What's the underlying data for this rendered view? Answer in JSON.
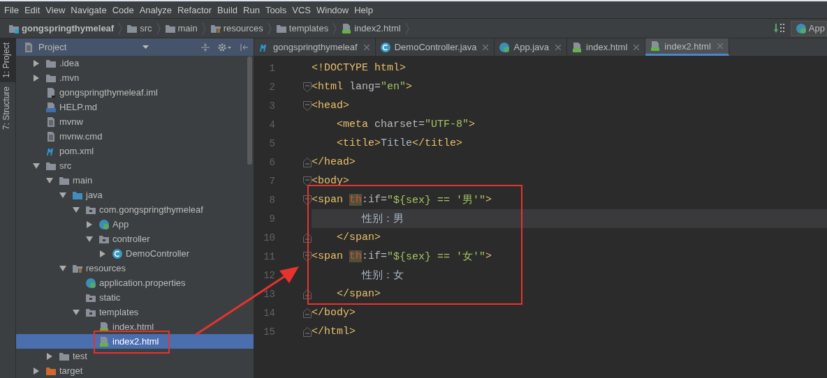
{
  "menu": [
    "File",
    "Edit",
    "View",
    "Navigate",
    "Code",
    "Analyze",
    "Refactor",
    "Build",
    "Run",
    "Tools",
    "VCS",
    "Window",
    "Help"
  ],
  "breadcrumb": [
    {
      "label": "gongspringthymeleaf",
      "kind": "module"
    },
    {
      "label": "src",
      "kind": "folder"
    },
    {
      "label": "main",
      "kind": "folder"
    },
    {
      "label": "resources",
      "kind": "resources"
    },
    {
      "label": "templates",
      "kind": "folder"
    },
    {
      "label": "index2.html",
      "kind": "html"
    }
  ],
  "run_config": {
    "label": "App"
  },
  "tool_strip": [
    {
      "label": "1: Project",
      "selected": true
    },
    {
      "label": "7: Structure",
      "selected": false
    }
  ],
  "project": {
    "title": "Project",
    "tree": [
      {
        "label": ".idea",
        "kind": "folder",
        "expanded": false,
        "selected": false
      },
      {
        "label": ".mvn",
        "kind": "folder",
        "expanded": false,
        "selected": false
      },
      {
        "label": "gongspringthymeleaf.iml",
        "kind": "iml",
        "selected": false
      },
      {
        "label": "HELP.md",
        "kind": "md",
        "selected": false
      },
      {
        "label": "mvnw",
        "kind": "text",
        "selected": false
      },
      {
        "label": "mvnw.cmd",
        "kind": "text",
        "selected": false
      },
      {
        "label": "pom.xml",
        "kind": "maven",
        "selected": false
      },
      {
        "label": "src",
        "kind": "folder",
        "expanded": true,
        "selected": false,
        "children": [
          {
            "label": "main",
            "kind": "folder",
            "expanded": true,
            "selected": false,
            "children": [
              {
                "label": "java",
                "kind": "source",
                "expanded": true,
                "selected": false,
                "children": [
                  {
                    "label": "com.gongspringthymeleaf",
                    "kind": "package",
                    "expanded": true,
                    "selected": false,
                    "children": [
                      {
                        "label": "App",
                        "kind": "spring",
                        "expanded": false,
                        "selected": false
                      },
                      {
                        "label": "controller",
                        "kind": "package",
                        "expanded": true,
                        "selected": false,
                        "children": [
                          {
                            "label": "DemoController",
                            "kind": "class",
                            "expanded": false,
                            "selected": false
                          }
                        ]
                      }
                    ]
                  }
                ]
              },
              {
                "label": "resources",
                "kind": "resources",
                "expanded": true,
                "selected": false,
                "children": [
                  {
                    "label": "application.properties",
                    "kind": "spring",
                    "selected": false
                  },
                  {
                    "label": "static",
                    "kind": "package",
                    "selected": false
                  },
                  {
                    "label": "templates",
                    "kind": "package",
                    "expanded": true,
                    "selected": false,
                    "children": [
                      {
                        "label": "index.html",
                        "kind": "html",
                        "selected": false
                      },
                      {
                        "label": "index2.html",
                        "kind": "html",
                        "selected": true
                      }
                    ]
                  }
                ]
              }
            ]
          },
          {
            "label": "test",
            "kind": "folder",
            "expanded": false,
            "selected": false
          }
        ]
      },
      {
        "label": "target",
        "kind": "excluded",
        "expanded": false,
        "selected": false
      }
    ]
  },
  "tabs": [
    {
      "label": "gongspringthymeleaf",
      "kind": "maven",
      "selected": false
    },
    {
      "label": "DemoController.java",
      "kind": "class",
      "selected": false
    },
    {
      "label": "App.java",
      "kind": "spring",
      "selected": false
    },
    {
      "label": "index.html",
      "kind": "html",
      "selected": false
    },
    {
      "label": "index2.html",
      "kind": "html",
      "selected": true
    }
  ],
  "editor": {
    "lines": [
      {
        "number": "1",
        "kind": "plain",
        "current": false,
        "tokens": [
          {
            "text": "<!DOCTYPE html>",
            "kind": "tag"
          }
        ]
      },
      {
        "number": "2",
        "kind": "foldstart",
        "current": false,
        "tokens": [
          {
            "text": "<html",
            "kind": "tag"
          },
          {
            "text": " lang=",
            "kind": "attr"
          },
          {
            "text": "\"en\"",
            "kind": "string"
          },
          {
            "text": ">",
            "kind": "tag"
          }
        ]
      },
      {
        "number": "3",
        "kind": "foldstart",
        "current": false,
        "tokens": [
          {
            "text": "<head>",
            "kind": "tag"
          }
        ]
      },
      {
        "number": "4",
        "kind": "plain",
        "current": false,
        "tokens": [
          {
            "text": "    <meta",
            "kind": "tag"
          },
          {
            "text": " charset=",
            "kind": "attr"
          },
          {
            "text": "\"UTF-8\"",
            "kind": "string"
          },
          {
            "text": ">",
            "kind": "tag"
          }
        ]
      },
      {
        "number": "5",
        "kind": "plain",
        "current": false,
        "tokens": [
          {
            "text": "    <title>",
            "kind": "tag"
          },
          {
            "text": "Title",
            "kind": "text"
          },
          {
            "text": "</title>",
            "kind": "tag"
          }
        ]
      },
      {
        "number": "6",
        "kind": "foldend",
        "current": false,
        "tokens": [
          {
            "text": "</head>",
            "kind": "tag"
          }
        ]
      },
      {
        "number": "7",
        "kind": "foldstart",
        "current": false,
        "tokens": [
          {
            "text": "<body>",
            "kind": "tag"
          }
        ]
      },
      {
        "number": "8",
        "kind": "foldstart",
        "current": false,
        "tokens": [
          {
            "text": "<span ",
            "kind": "tag"
          },
          {
            "text": "th",
            "kind": "namespace"
          },
          {
            "text": ":if=",
            "kind": "attr"
          },
          {
            "text": "\"${sex} == '男'\"",
            "kind": "string"
          },
          {
            "text": ">",
            "kind": "tag"
          }
        ]
      },
      {
        "number": "9",
        "kind": "plain",
        "current": true,
        "tokens": [
          {
            "text": "        性别：男",
            "kind": "text"
          }
        ]
      },
      {
        "number": "10",
        "kind": "foldend",
        "current": false,
        "tokens": [
          {
            "text": "    </span>",
            "kind": "tag"
          }
        ]
      },
      {
        "number": "11",
        "kind": "foldstart",
        "current": false,
        "tokens": [
          {
            "text": "<span ",
            "kind": "tag"
          },
          {
            "text": "th",
            "kind": "namespace"
          },
          {
            "text": ":if=",
            "kind": "attr"
          },
          {
            "text": "\"${sex} == '女'\"",
            "kind": "string"
          },
          {
            "text": ">",
            "kind": "tag"
          }
        ]
      },
      {
        "number": "12",
        "kind": "plain",
        "current": false,
        "tokens": [
          {
            "text": "        性别：女",
            "kind": "text"
          }
        ]
      },
      {
        "number": "13",
        "kind": "foldend",
        "current": false,
        "tokens": [
          {
            "text": "    </span>",
            "kind": "tag"
          }
        ]
      },
      {
        "number": "14",
        "kind": "foldend",
        "current": false,
        "tokens": [
          {
            "text": "</body>",
            "kind": "tag"
          }
        ]
      },
      {
        "number": "15",
        "kind": "foldend",
        "current": false,
        "tokens": [
          {
            "text": "</html>",
            "kind": "tag"
          }
        ]
      }
    ]
  }
}
